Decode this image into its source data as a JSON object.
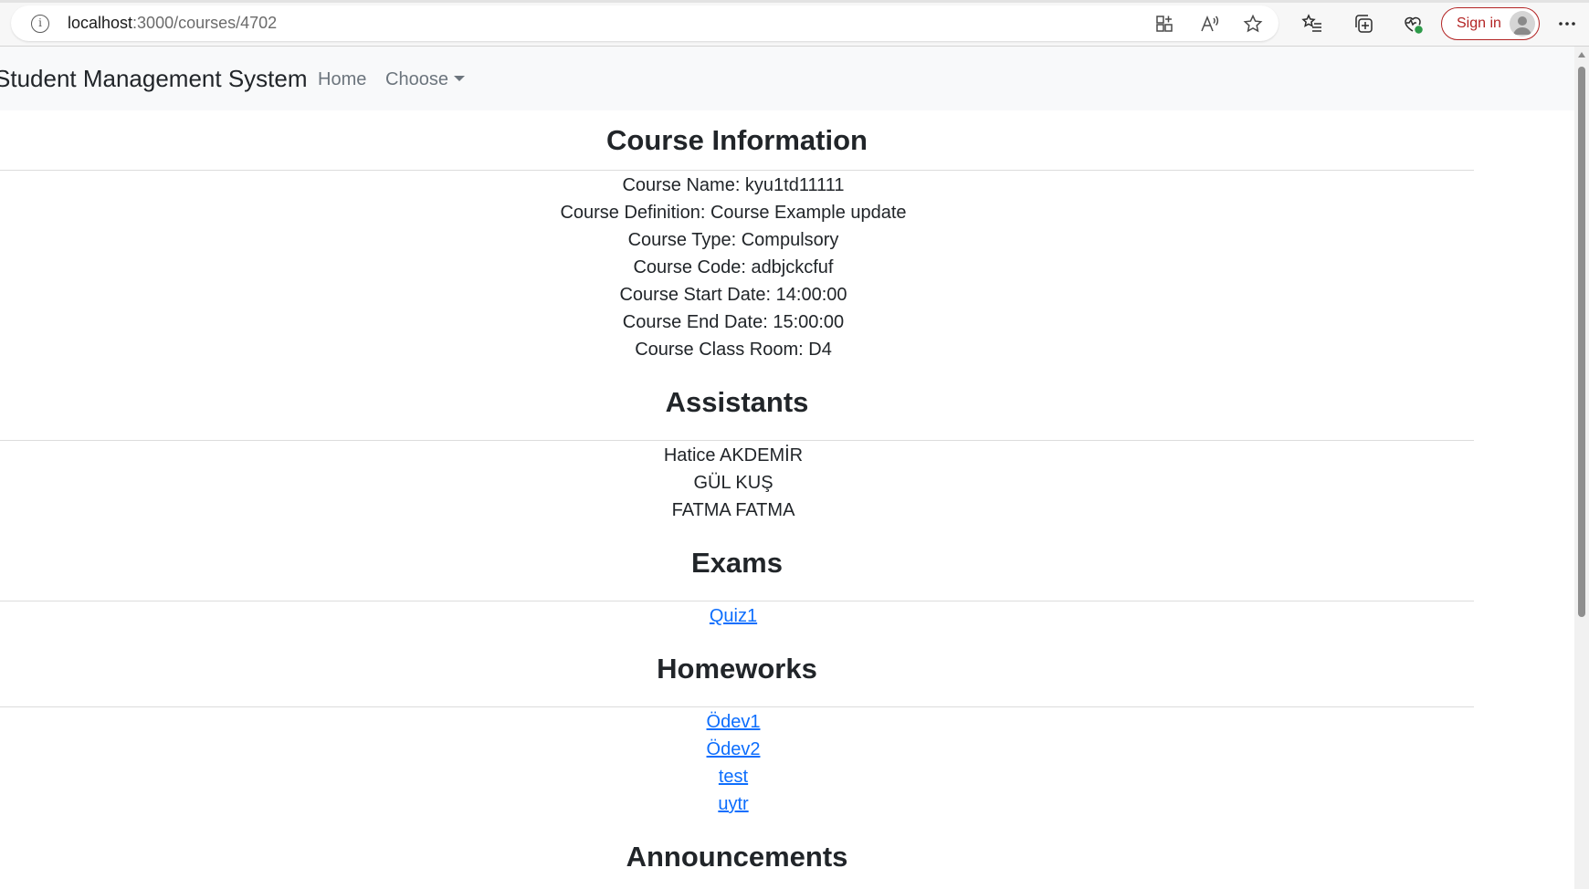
{
  "browser": {
    "url_host": "localhost",
    "url_path": ":3000/courses/4702",
    "sign_in_label": "Sign in"
  },
  "navbar": {
    "brand": "Student Management System",
    "home_label": "Home",
    "choose_label": "Choose"
  },
  "course_info": {
    "title": "Course Information",
    "name": "Course Name: kyu1td11111",
    "definition": "Course Definition: Course Example update",
    "type": "Course Type: Compulsory",
    "code": "Course Code: adbjckcfuf",
    "start_date": "Course Start Date: 14:00:00",
    "end_date": "Course End Date: 15:00:00",
    "class_room": "Course Class Room: D4"
  },
  "assistants": {
    "title": "Assistants",
    "items": [
      "Hatice AKDEMİR",
      "GÜL KUŞ",
      "FATMA FATMA"
    ]
  },
  "exams": {
    "title": "Exams",
    "items": [
      "Quiz1"
    ]
  },
  "homeworks": {
    "title": "Homeworks",
    "items": [
      "Ödev1",
      "Ödev2",
      "test",
      "uytr"
    ]
  },
  "announcements": {
    "title": "Announcements"
  }
}
